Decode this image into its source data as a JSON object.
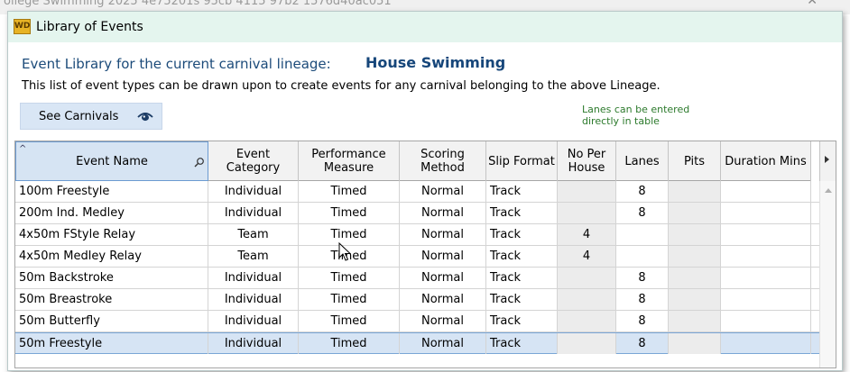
{
  "background_window": {
    "title": "ollege Swimming 2025 4e75201s 95cb 4115 97b2 1576d40ac051",
    "close": "✕"
  },
  "dialog": {
    "app_icon": "WD",
    "title": "Library of Events"
  },
  "header": {
    "library_label": "Event Library for the current carnival lineage:",
    "lineage_name": "House Swimming",
    "description": "This list of event types can be drawn upon to create events for any carnival belonging to the above Lineage."
  },
  "toolbar": {
    "see_carnivals_label": "See Carnivals",
    "see_carnivals_icon": "eye-icon",
    "hint_line1": "Lanes can be entered",
    "hint_line2": "directly in table"
  },
  "table": {
    "columns": [
      {
        "key": "event_name",
        "label": "Event Name"
      },
      {
        "key": "event_category",
        "label": "Event Category"
      },
      {
        "key": "performance_measure",
        "label": "Performance Measure"
      },
      {
        "key": "scoring_method",
        "label": "Scoring Method"
      },
      {
        "key": "slip_format",
        "label": "Slip Format"
      },
      {
        "key": "no_per_house",
        "label": "No Per House"
      },
      {
        "key": "lanes",
        "label": "Lanes"
      },
      {
        "key": "pits",
        "label": "Pits"
      },
      {
        "key": "duration_mins",
        "label": "Duration Mins"
      }
    ],
    "sort_indicator": "^",
    "rows": [
      {
        "event_name": "100m Freestyle",
        "event_category": "Individual",
        "performance_measure": "Timed",
        "scoring_method": "Normal",
        "slip_format": "Track",
        "no_per_house": "",
        "lanes": "8",
        "pits": "",
        "duration_mins": ""
      },
      {
        "event_name": "200m Ind. Medley",
        "event_category": "Individual",
        "performance_measure": "Timed",
        "scoring_method": "Normal",
        "slip_format": "Track",
        "no_per_house": "",
        "lanes": "8",
        "pits": "",
        "duration_mins": ""
      },
      {
        "event_name": "4x50m FStyle Relay",
        "event_category": "Team",
        "performance_measure": "Timed",
        "scoring_method": "Normal",
        "slip_format": "Track",
        "no_per_house": "4",
        "lanes": "",
        "pits": "",
        "duration_mins": ""
      },
      {
        "event_name": "4x50m Medley Relay",
        "event_category": "Team",
        "performance_measure": "Timed",
        "scoring_method": "Normal",
        "slip_format": "Track",
        "no_per_house": "4",
        "lanes": "",
        "pits": "",
        "duration_mins": ""
      },
      {
        "event_name": "50m Backstroke",
        "event_category": "Individual",
        "performance_measure": "Timed",
        "scoring_method": "Normal",
        "slip_format": "Track",
        "no_per_house": "",
        "lanes": "8",
        "pits": "",
        "duration_mins": ""
      },
      {
        "event_name": "50m Breastroke",
        "event_category": "Individual",
        "performance_measure": "Timed",
        "scoring_method": "Normal",
        "slip_format": "Track",
        "no_per_house": "",
        "lanes": "8",
        "pits": "",
        "duration_mins": ""
      },
      {
        "event_name": "50m Butterfly",
        "event_category": "Individual",
        "performance_measure": "Timed",
        "scoring_method": "Normal",
        "slip_format": "Track",
        "no_per_house": "",
        "lanes": "8",
        "pits": "",
        "duration_mins": ""
      },
      {
        "event_name": "50m Freestyle",
        "event_category": "Individual",
        "performance_measure": "Timed",
        "scoring_method": "Normal",
        "slip_format": "Track",
        "no_per_house": "",
        "lanes": "8",
        "pits": "",
        "duration_mins": "",
        "selected": true
      }
    ]
  },
  "colors": {
    "accent_title": "#16467a",
    "hint_green": "#2c7a2c",
    "selected_row": "#d6e4f4"
  }
}
